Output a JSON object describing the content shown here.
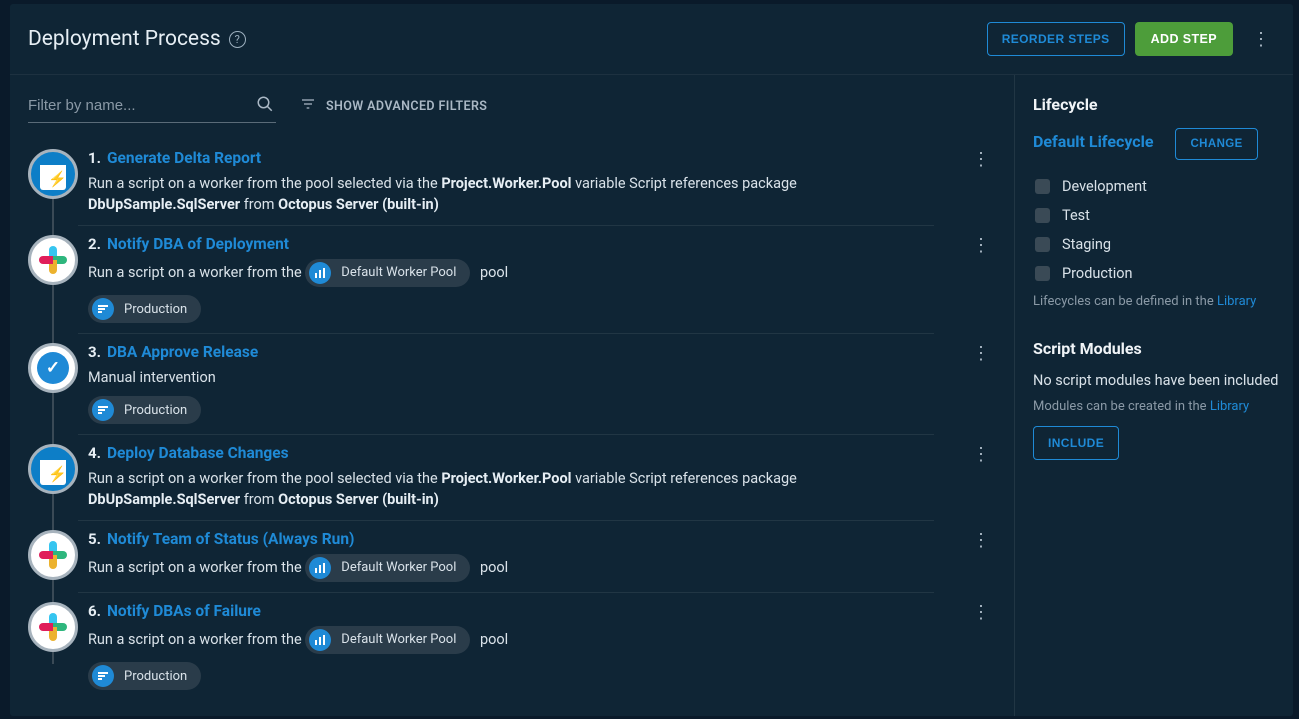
{
  "header": {
    "title": "Deployment Process",
    "reorder_label": "REORDER STEPS",
    "add_label": "ADD STEP"
  },
  "filter": {
    "placeholder": "Filter by name...",
    "advanced_label": "SHOW ADVANCED FILTERS"
  },
  "steps": [
    {
      "num": "1.",
      "title": "Generate Delta Report",
      "desc_prefix": "Run a script on a worker from the pool selected via the ",
      "desc_bold1": "Project.Worker.Pool",
      "desc_mid": " variable Script references package ",
      "desc_bold2": "DbUpSample.SqlServer",
      "desc_from": " from ",
      "desc_bold3": "Octopus Server (built-in)",
      "icon": "db",
      "pool_badge": null,
      "env_badges": []
    },
    {
      "num": "2.",
      "title": "Notify DBA of Deployment",
      "desc_prefix": "Run a script on a worker from the ",
      "desc_suffix": " pool",
      "icon": "slack",
      "pool_badge": "Default Worker Pool",
      "env_badges": [
        "Production"
      ]
    },
    {
      "num": "3.",
      "title": "DBA Approve Release",
      "desc_prefix": "Manual intervention",
      "icon": "check",
      "pool_badge": null,
      "env_badges": [
        "Production"
      ]
    },
    {
      "num": "4.",
      "title": "Deploy Database Changes",
      "desc_prefix": "Run a script on a worker from the pool selected via the ",
      "desc_bold1": "Project.Worker.Pool",
      "desc_mid": " variable Script references package ",
      "desc_bold2": "DbUpSample.SqlServer",
      "desc_from": " from ",
      "desc_bold3": "Octopus Server (built-in)",
      "icon": "db",
      "pool_badge": null,
      "env_badges": []
    },
    {
      "num": "5.",
      "title": "Notify Team of Status (Always Run)",
      "desc_prefix": "Run a script on a worker from the ",
      "desc_suffix": " pool",
      "icon": "slack",
      "pool_badge": "Default Worker Pool",
      "env_badges": []
    },
    {
      "num": "6.",
      "title": "Notify DBAs of Failure",
      "desc_prefix": "Run a script on a worker from the ",
      "desc_suffix": " pool",
      "icon": "slack",
      "pool_badge": "Default Worker Pool",
      "env_badges": [
        "Production"
      ]
    }
  ],
  "sidebar": {
    "lifecycle_heading": "Lifecycle",
    "lifecycle_name": "Default Lifecycle",
    "change_label": "CHANGE",
    "environments": [
      "Development",
      "Test",
      "Staging",
      "Production"
    ],
    "lifecycle_note_prefix": "Lifecycles can be defined in the ",
    "lifecycle_note_link": "Library",
    "scripts_heading": "Script Modules",
    "scripts_empty": "No script modules have been included",
    "scripts_note_prefix": "Modules can be created in the ",
    "scripts_note_link": "Library",
    "include_label": "INCLUDE"
  }
}
